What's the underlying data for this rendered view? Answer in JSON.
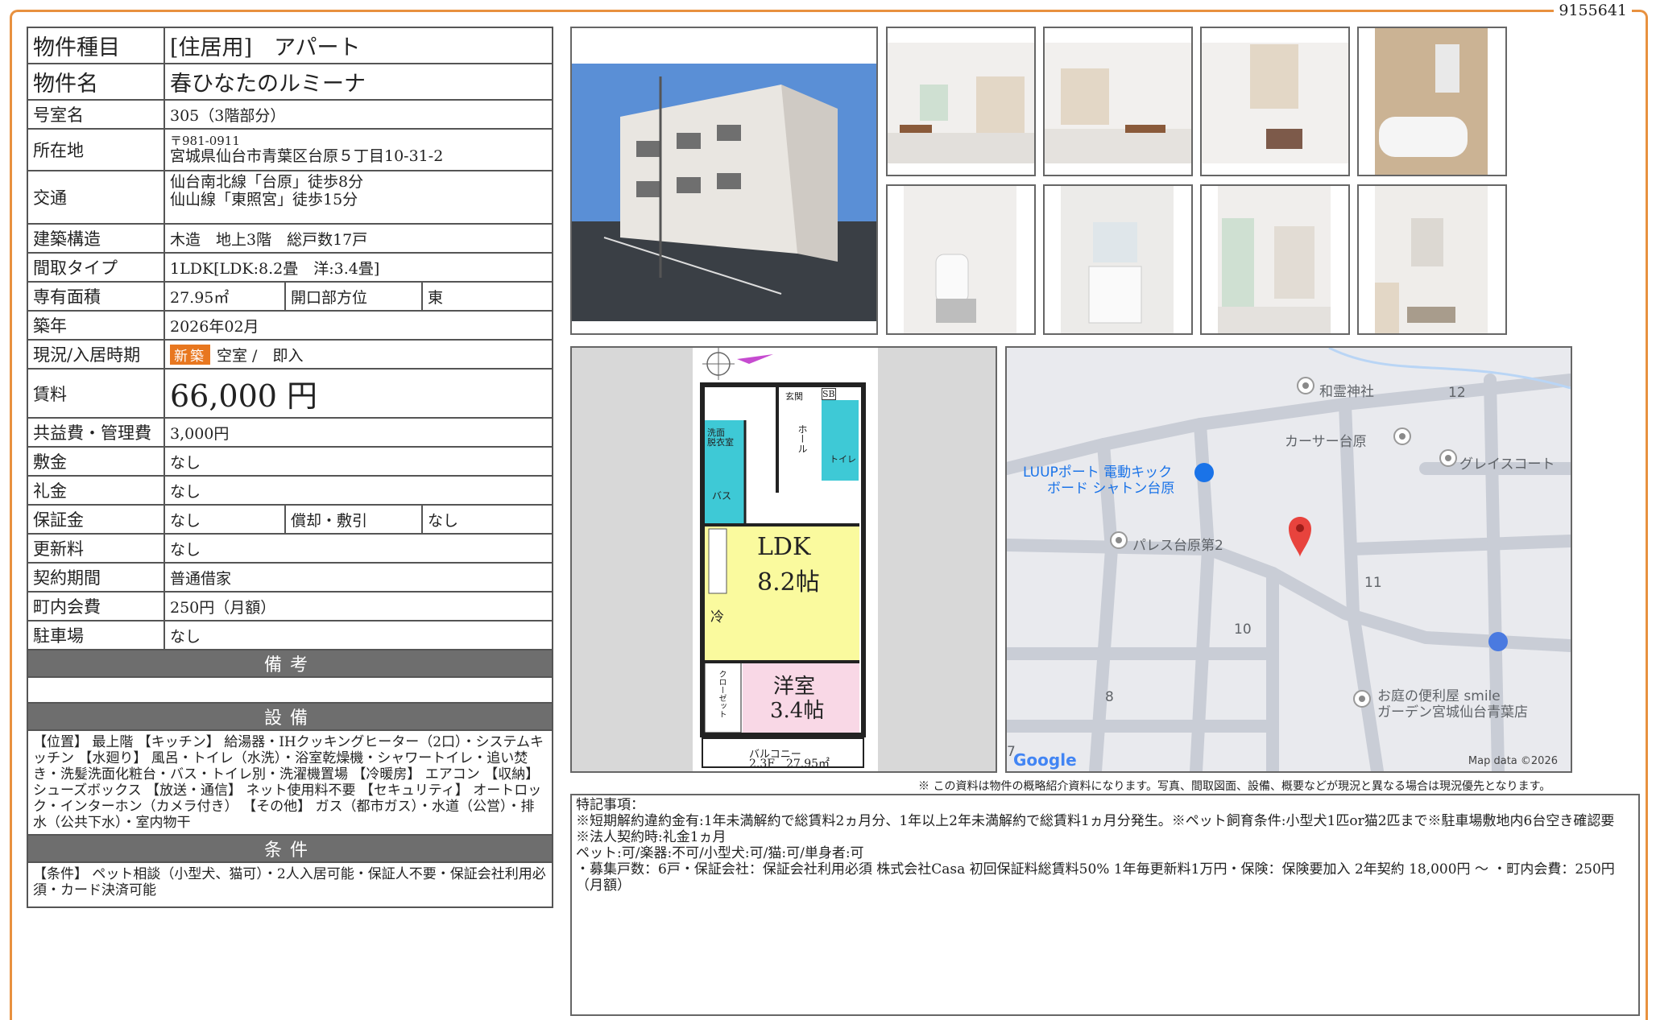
{
  "doc_id": "9155641",
  "spec": {
    "type_label": "物件種目",
    "type_value": "[住居用]　アパート",
    "name_label": "物件名",
    "name_value": "春ひなたのルミーナ",
    "room_label": "号室名",
    "room_value": "305（3階部分）",
    "address_label": "所在地",
    "postal": "〒981-0911",
    "address_value": "宮城県仙台市青葉区台原５丁目10-31-2",
    "access_label": "交通",
    "access_line1": "仙台南北線「台原」徒歩8分",
    "access_line2": "仙山線「東照宮」徒歩15分",
    "structure_label": "建築構造",
    "structure_value": "木造　地上3階　総戸数17戸",
    "layout_label": "間取タイプ",
    "layout_value": "1LDK[LDK:8.2畳　洋:3.4畳]",
    "area_label": "専有面積",
    "area_value": "27.95㎡",
    "direction_label": "開口部方位",
    "direction_value": "東",
    "built_label": "築年",
    "built_value": "2026年02月",
    "status_label": "現況/入居時期",
    "status_badge": "新築",
    "status_value": "空室 /　即入",
    "rent_label": "賃料",
    "rent_value": "66,000 円",
    "fee_label": "共益費・管理費",
    "fee_value": "3,000円",
    "deposit_label": "敷金",
    "deposit_value": "なし",
    "keymoney_label": "礼金",
    "keymoney_value": "なし",
    "guarantee_label": "保証金",
    "guarantee_value": "なし",
    "amort_label": "償却・敷引",
    "amort_value": "なし",
    "renewal_label": "更新料",
    "renewal_value": "なし",
    "contract_label": "契約期間",
    "contract_value": "普通借家",
    "community_label": "町内会費",
    "community_value": "250円（月額）",
    "parking_label": "駐車場",
    "parking_value": "なし"
  },
  "sections": {
    "remarks_title": "備考",
    "equipment_title": "設備",
    "equipment_text": "【位置】 最上階 【キッチン】 給湯器・IHクッキングヒーター（2口）・システムキッチン 【水廻り】 風呂・トイレ（水洗）・浴室乾燥機・シャワートイレ・追い焚き・洗髪洗面化粧台・バス・トイレ別・洗濯機置場 【冷暖房】 エアコン 【収納】 シューズボックス 【放送・通信】 ネット使用料不要 【セキュリティ】 オートロック・インターホン（カメラ付き） 【その他】 ガス（都市ガス）・水道（公営）・排水（公共下水）・室内物干",
    "conditions_title": "条件",
    "conditions_text": "【条件】 ペット相談（小型犬、猫可）・2人入居可能・保証人不要・保証会社利用必須・カード決済可能"
  },
  "floorplan": {
    "entrance": "玄関",
    "sb": "SB",
    "hall": "ホール",
    "toilet": "トイレ",
    "washroom": "洗面\n脱衣室",
    "bath": "バス",
    "ldk": "LDK",
    "ldk_size": "8.2帖",
    "fridge": "冷",
    "western": "洋室",
    "western_size": "3.4帖",
    "closet": "クローゼット",
    "balcony": "バルコニー",
    "caption": "2.3F　27.95㎡"
  },
  "map": {
    "labels": [
      "和霊神社",
      "カーサー台原",
      "グレイスコート",
      "LUUPポート 電動キック",
      "ボード シャトン台原",
      "パレス台原第2",
      "お庭の便利屋 smile",
      "ガーデン宮城仙台青葉店"
    ],
    "numbers": [
      "12",
      "11",
      "10",
      "8",
      "7"
    ],
    "google": "Google",
    "copyright": "Map data ©2026"
  },
  "notice": "※ この資料は物件の概略紹介資料になります。写真、間取図面、設備、概要などが現況と異なる場合は現況優先となります。",
  "remarks": {
    "title": "特記事項：",
    "line1": "※短期解約違約金有:1年未満解約で総賃料2ヵ月分、1年以上2年未満解約で総賃料1ヵ月分発生。※ペット飼育条件:小型犬1匹or猫2匹まで※駐車場敷地内6台空き確認要　※法人契約時:礼金1ヵ月",
    "line2": "ペット:可/楽器:不可/小型犬:可/猫:可/単身者:可",
    "line3": "・募集戸数：6戸・保証会社：保証会社利用必須 株式会社Casa 初回保証料総賃料50% 1年毎更新料1万円・保険：保険要加入 2年契約 18,000円 〜 ・町内会費：250円（月額）"
  }
}
